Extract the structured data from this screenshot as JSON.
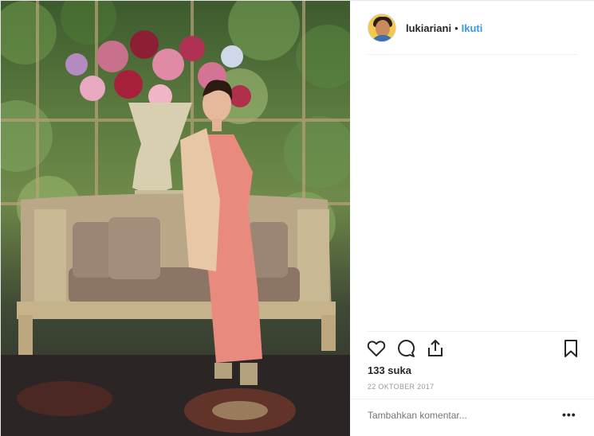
{
  "post": {
    "username": "lukiariani",
    "separator": "•",
    "follow_label": "Ikuti",
    "likes_text": "133 suka",
    "date_text": "22 OKTOBER 2017",
    "comment_placeholder": "Tambahkan komentar...",
    "more_label": "•••"
  },
  "photo": {
    "subject": "woman in pink kebaya standing beside gold bench with floral arrangement"
  },
  "icons": {
    "like": "heart-icon",
    "comment": "comment-bubble-icon",
    "share": "share-icon",
    "save": "bookmark-icon"
  },
  "colors": {
    "accent": "#3897f0",
    "text": "#262626",
    "muted": "#999999",
    "border": "#efefef"
  }
}
